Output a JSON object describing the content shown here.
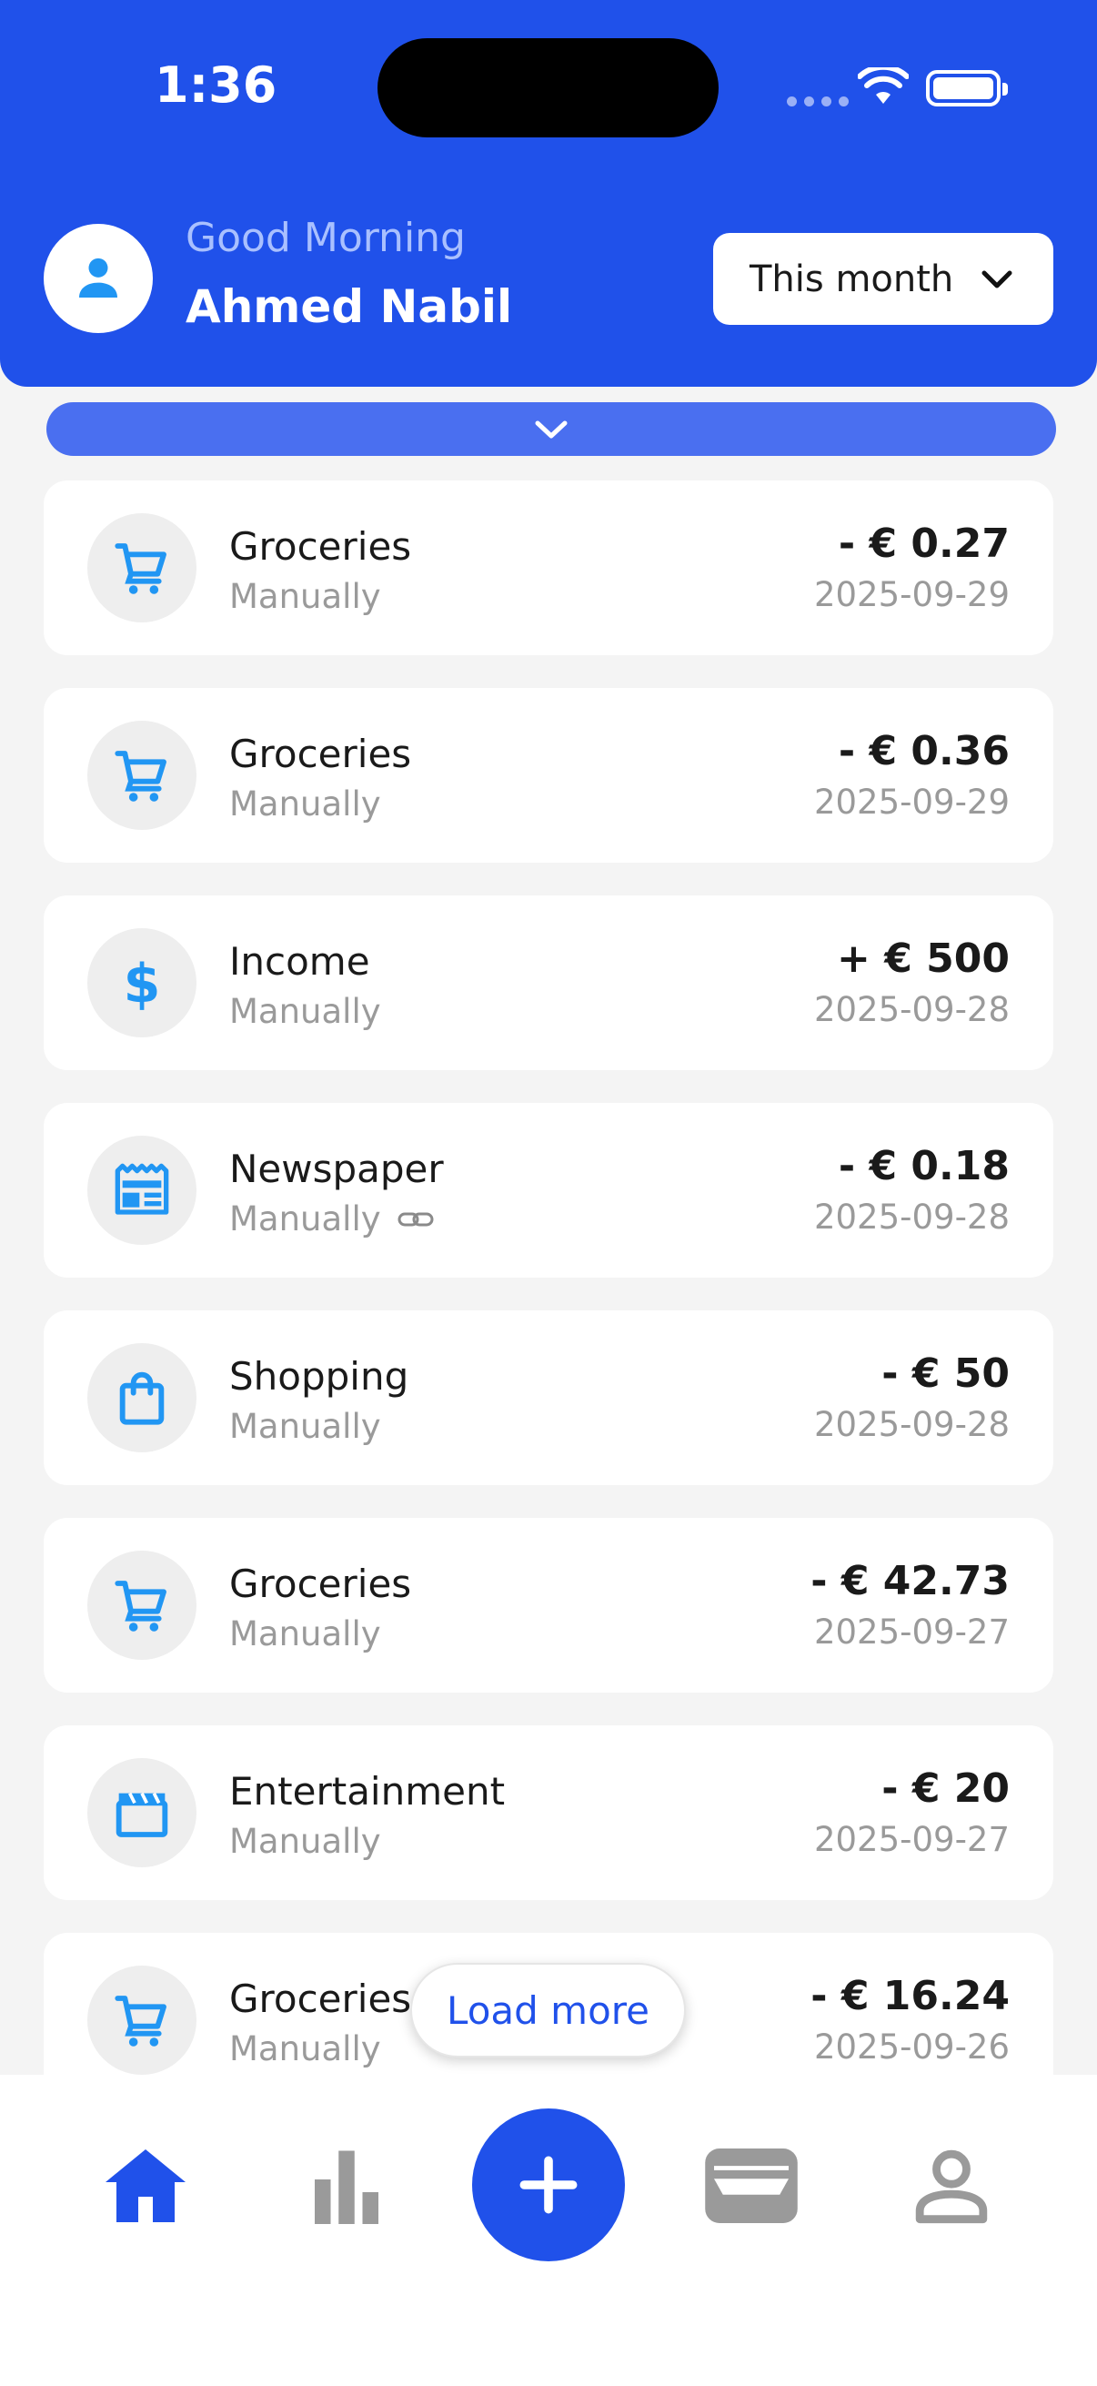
{
  "status_bar": {
    "time": "1:36"
  },
  "header": {
    "greeting": "Good Morning",
    "user_name": "Ahmed Nabil",
    "period_label": "This month"
  },
  "transactions": [
    {
      "title": "Groceries",
      "source": "Manually",
      "amount": "- € 0.27",
      "date": "2025-09-29",
      "icon": "cart-icon",
      "linked": false
    },
    {
      "title": "Groceries",
      "source": "Manually",
      "amount": "- € 0.36",
      "date": "2025-09-29",
      "icon": "cart-icon",
      "linked": false
    },
    {
      "title": "Income",
      "source": "Manually",
      "amount": "+ € 500",
      "date": "2025-09-28",
      "icon": "dollar-icon",
      "linked": false
    },
    {
      "title": "Newspaper",
      "source": "Manually",
      "amount": "- € 0.18",
      "date": "2025-09-28",
      "icon": "newspaper-icon",
      "linked": true
    },
    {
      "title": "Shopping",
      "source": "Manually",
      "amount": "- € 50",
      "date": "2025-09-28",
      "icon": "shopping-bag-icon",
      "linked": false
    },
    {
      "title": "Groceries",
      "source": "Manually",
      "amount": "- € 42.73",
      "date": "2025-09-27",
      "icon": "cart-icon",
      "linked": false
    },
    {
      "title": "Entertainment",
      "source": "Manually",
      "amount": "- € 20",
      "date": "2025-09-27",
      "icon": "clapperboard-icon",
      "linked": false
    },
    {
      "title": "Groceries",
      "source": "Manually",
      "amount": "- € 16.24",
      "date": "2025-09-26",
      "icon": "cart-icon",
      "linked": false
    }
  ],
  "load_more_label": "Load more",
  "bottom_nav": {
    "items": [
      "home-icon",
      "bar-chart-icon",
      "plus-icon",
      "wallet-icon",
      "profile-icon"
    ],
    "active": "home-icon"
  },
  "colors": {
    "primary": "#2051EA",
    "icon_accent": "#2196F3",
    "muted": "#9a9a9a"
  }
}
